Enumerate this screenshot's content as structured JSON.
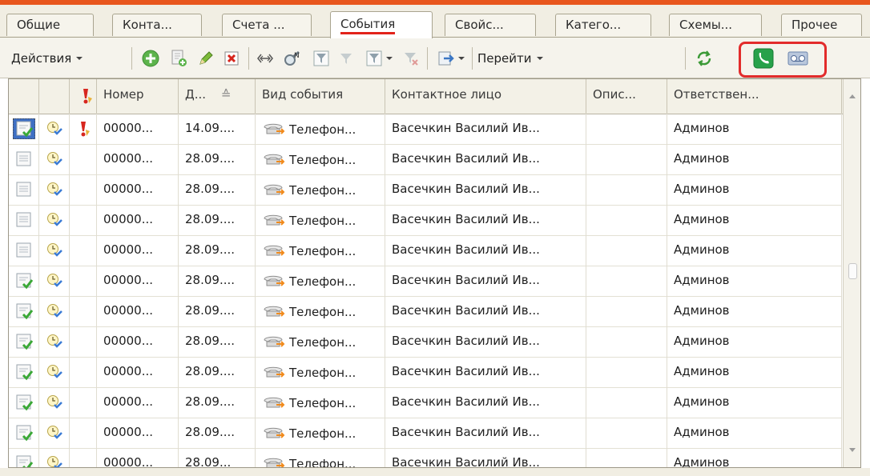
{
  "tabs": [
    {
      "label": "Общие",
      "active": false
    },
    {
      "label": "Конта...",
      "active": false
    },
    {
      "label": "Счета ...",
      "active": false
    },
    {
      "label": "События",
      "active": true
    },
    {
      "label": "Свойс...",
      "active": false
    },
    {
      "label": "Катего...",
      "active": false
    },
    {
      "label": "Схемы...",
      "active": false
    },
    {
      "label": "Прочее",
      "active": false
    }
  ],
  "toolbar": {
    "actions_label": "Действия",
    "goto_label": "Перейти"
  },
  "table": {
    "columns": [
      "",
      "",
      "!",
      "Номер",
      "Д...",
      "Вид события",
      "Контактное лицо",
      "Опис...",
      "Ответствен..."
    ],
    "sort_indicator": "≙",
    "rows": [
      {
        "state": "done-selected",
        "priority": true,
        "number": "00000...",
        "date": "14.09....",
        "type": "Телефон...",
        "contact": "Васечкин Василий Ив...",
        "description": "",
        "responsible": "Админов"
      },
      {
        "state": "planned",
        "priority": false,
        "number": "00000...",
        "date": "28.09....",
        "type": "Телефон...",
        "contact": "Васечкин Василий Ив...",
        "description": "",
        "responsible": "Админов"
      },
      {
        "state": "planned",
        "priority": false,
        "number": "00000...",
        "date": "28.09....",
        "type": "Телефон...",
        "contact": "Васечкин Василий Ив...",
        "description": "",
        "responsible": "Админов"
      },
      {
        "state": "planned",
        "priority": false,
        "number": "00000...",
        "date": "28.09....",
        "type": "Телефон...",
        "contact": "Васечкин Василий Ив...",
        "description": "",
        "responsible": "Админов"
      },
      {
        "state": "planned",
        "priority": false,
        "number": "00000...",
        "date": "28.09....",
        "type": "Телефон...",
        "contact": "Васечкин Василий Ив...",
        "description": "",
        "responsible": "Админов"
      },
      {
        "state": "done",
        "priority": false,
        "number": "00000...",
        "date": "28.09....",
        "type": "Телефон...",
        "contact": "Васечкин Василий Ив...",
        "description": "",
        "responsible": "Админов"
      },
      {
        "state": "done",
        "priority": false,
        "number": "00000...",
        "date": "28.09....",
        "type": "Телефон...",
        "contact": "Васечкин Василий Ив...",
        "description": "",
        "responsible": "Админов"
      },
      {
        "state": "done",
        "priority": false,
        "number": "00000...",
        "date": "28.09....",
        "type": "Телефон...",
        "contact": "Васечкин Василий Ив...",
        "description": "",
        "responsible": "Админов"
      },
      {
        "state": "done",
        "priority": false,
        "number": "00000...",
        "date": "28.09....",
        "type": "Телефон...",
        "contact": "Васечкин Василий Ив...",
        "description": "",
        "responsible": "Админов"
      },
      {
        "state": "done",
        "priority": false,
        "number": "00000...",
        "date": "28.09....",
        "type": "Телефон...",
        "contact": "Васечкин Василий Ив...",
        "description": "",
        "responsible": "Админов"
      },
      {
        "state": "done",
        "priority": false,
        "number": "00000...",
        "date": "28.09....",
        "type": "Телефон...",
        "contact": "Васечкин Василий Ив...",
        "description": "",
        "responsible": "Админов"
      },
      {
        "state": "done",
        "priority": false,
        "number": "00000...",
        "date": "28.09...",
        "type": "Телефон...",
        "contact": "Васечкин Василий Ив...",
        "description": "",
        "responsible": "Админов"
      }
    ]
  },
  "icons": {
    "add": "add-circle-icon",
    "copy": "copy-document-icon",
    "edit": "pencil-icon",
    "delete": "delete-x-icon",
    "hierarchy": "hierarchy-arrows-icon",
    "find": "find-magnifier-icon",
    "filter": "filter-icon",
    "goto": "goto-arrow-icon",
    "refresh": "refresh-icon",
    "phone": "phone-call-icon",
    "tape": "voicemail-icon"
  },
  "colors": {
    "accent_bar": "#e8561d",
    "highlight_box": "#e22b2b",
    "active_tab_underline": "#e2231a"
  }
}
